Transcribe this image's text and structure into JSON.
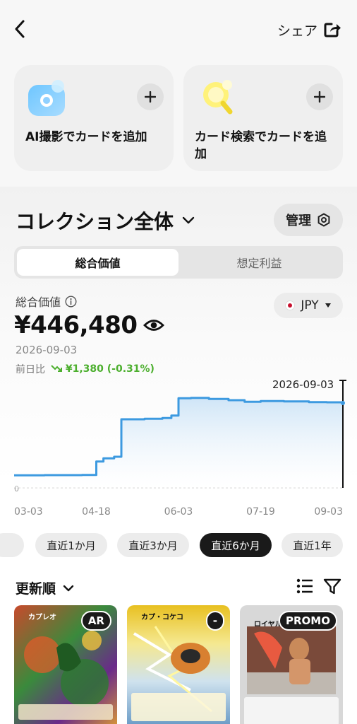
{
  "header": {
    "share_label": "シェア"
  },
  "add_cards": [
    {
      "label": "AI撮影でカードを追加"
    },
    {
      "label": "カード検索でカードを追加"
    }
  ],
  "collection": {
    "title": "コレクション全体",
    "manage_label": "管理",
    "tabs": [
      "総合価値",
      "想定利益"
    ],
    "active_tab": 0,
    "value_label": "総合価値",
    "currency": "JPY",
    "total_value": "¥446,480",
    "date": "2026-09-03",
    "change_prefix": "前日比",
    "change_value": "¥1,380 (-0.31%)",
    "colors": {
      "accent": "#3d9ae0",
      "positive": "#4caf2e"
    }
  },
  "chart_data": {
    "type": "area",
    "x": [
      "2026-03-03",
      "2026-03-20",
      "2026-04-10",
      "2026-04-18",
      "2026-04-22",
      "2026-04-28",
      "2026-05-02",
      "2026-05-15",
      "2026-05-25",
      "2026-05-30",
      "2026-06-03",
      "2026-06-10",
      "2026-06-20",
      "2026-07-01",
      "2026-07-10",
      "2026-07-19",
      "2026-08-01",
      "2026-08-15",
      "2026-08-25",
      "2026-09-03"
    ],
    "values": [
      53000,
      54000,
      55000,
      112000,
      125000,
      132000,
      291000,
      293000,
      296000,
      307000,
      380000,
      382000,
      377000,
      372000,
      365000,
      368000,
      367000,
      364000,
      363000,
      360000
    ],
    "x_tick_labels": [
      "03-03",
      "04-18",
      "06-03",
      "07-19",
      "09-03"
    ],
    "y_tick_labels": [
      "0"
    ],
    "ylim": [
      0,
      450000
    ],
    "highlight_label": "2026-09-03",
    "ranges": [
      "直近1か月",
      "直近3か月",
      "直近6か月",
      "直近1年"
    ],
    "active_range": 2
  },
  "list": {
    "sort_label": "更新順",
    "cards": [
      {
        "name": "カプレオ",
        "badge": "AR",
        "bg": "#3a8a3c"
      },
      {
        "name": "カプ・コケコ",
        "badge": "-",
        "bg": "#e8c020"
      },
      {
        "name": "ロイヤルマスク",
        "badge": "PROMO",
        "bg": "#d8d8d8"
      }
    ]
  }
}
